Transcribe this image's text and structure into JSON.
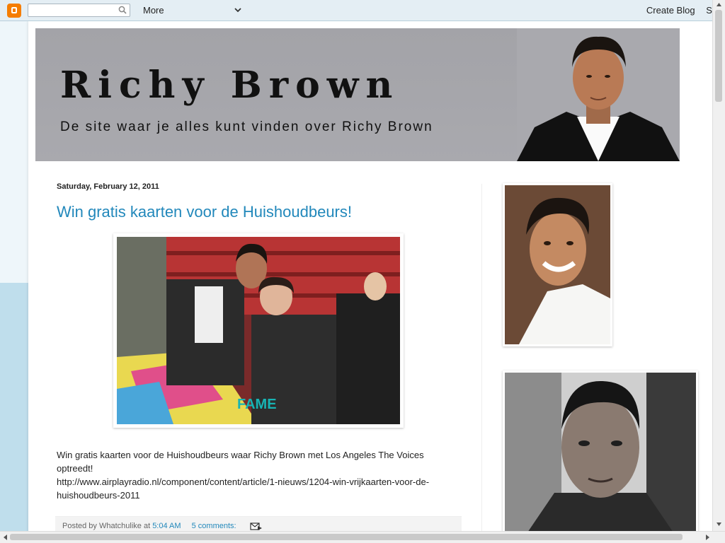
{
  "navbar": {
    "search_placeholder": "",
    "more_label": "More",
    "create_blog_label": "Create Blog",
    "sign_in_label": "Sig"
  },
  "header": {
    "title": "Richy Brown",
    "subtitle": "De site waar je alles kunt vinden over Richy Brown"
  },
  "post": {
    "date": "Saturday, February 12, 2011",
    "title": "Win gratis kaarten voor de Huishoudbeurs!",
    "image_logo_text": "FAME",
    "body_line1": "Win gratis kaarten voor de Huishoudbeurs waar Richy Brown met Los Angeles The Voices",
    "body_line2": "optreedt!",
    "body_line3": "http://www.airplayradio.nl/component/content/article/1-nieuws/1204-win-vrijkaarten-voor-de-",
    "body_line4": "huishoudbeurs-2011",
    "footer": {
      "posted_by": "Posted by Whatchulike at",
      "time": "5:04 AM",
      "comments": "5 comments:"
    }
  },
  "colors": {
    "accent_link": "#2288bb",
    "blogger_orange": "#f57d00",
    "header_bg": "#a6a6ab"
  },
  "icons": [
    "blogger-logo-icon",
    "search-icon",
    "chevron-down-icon",
    "email-icon"
  ]
}
